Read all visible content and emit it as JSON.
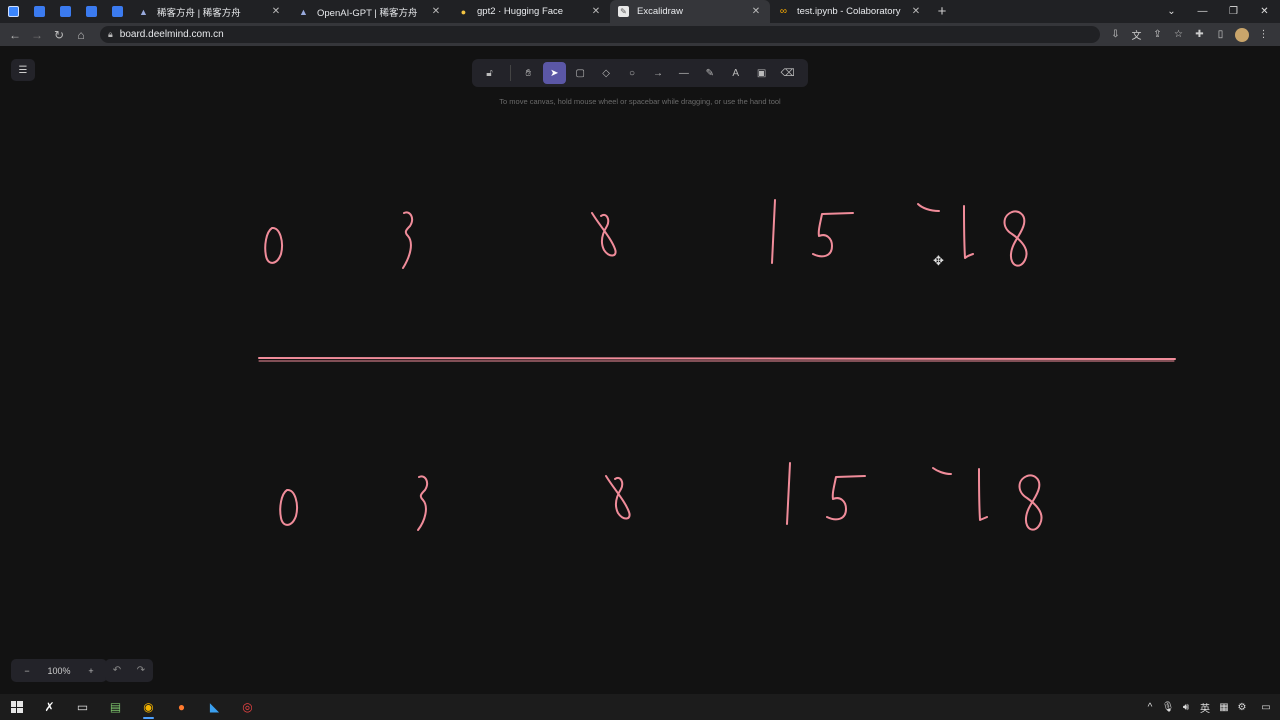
{
  "browser": {
    "tabs": [
      {
        "title": "稀客方舟 | 稀客方舟",
        "close": "✕"
      },
      {
        "title": "OpenAI-GPT | 稀客方舟",
        "close": "✕"
      },
      {
        "title": "gpt2 · Hugging Face",
        "close": "✕"
      },
      {
        "title": "Excalidraw",
        "close": "✕"
      },
      {
        "title": "test.ipynb - Colaboratory",
        "close": "✕"
      }
    ],
    "new_tab": "+",
    "url": "board.deelmind.com.cn"
  },
  "excalidraw": {
    "hint": "To move canvas, hold mouse wheel or spacebar while dragging, or use the hand tool",
    "zoom": "100%",
    "zoom_out": "−",
    "zoom_in": "+",
    "stroke_color": "#f08c9a",
    "selected_tool_color": "#5b57a6"
  },
  "taskbar": {
    "lang": "英"
  }
}
